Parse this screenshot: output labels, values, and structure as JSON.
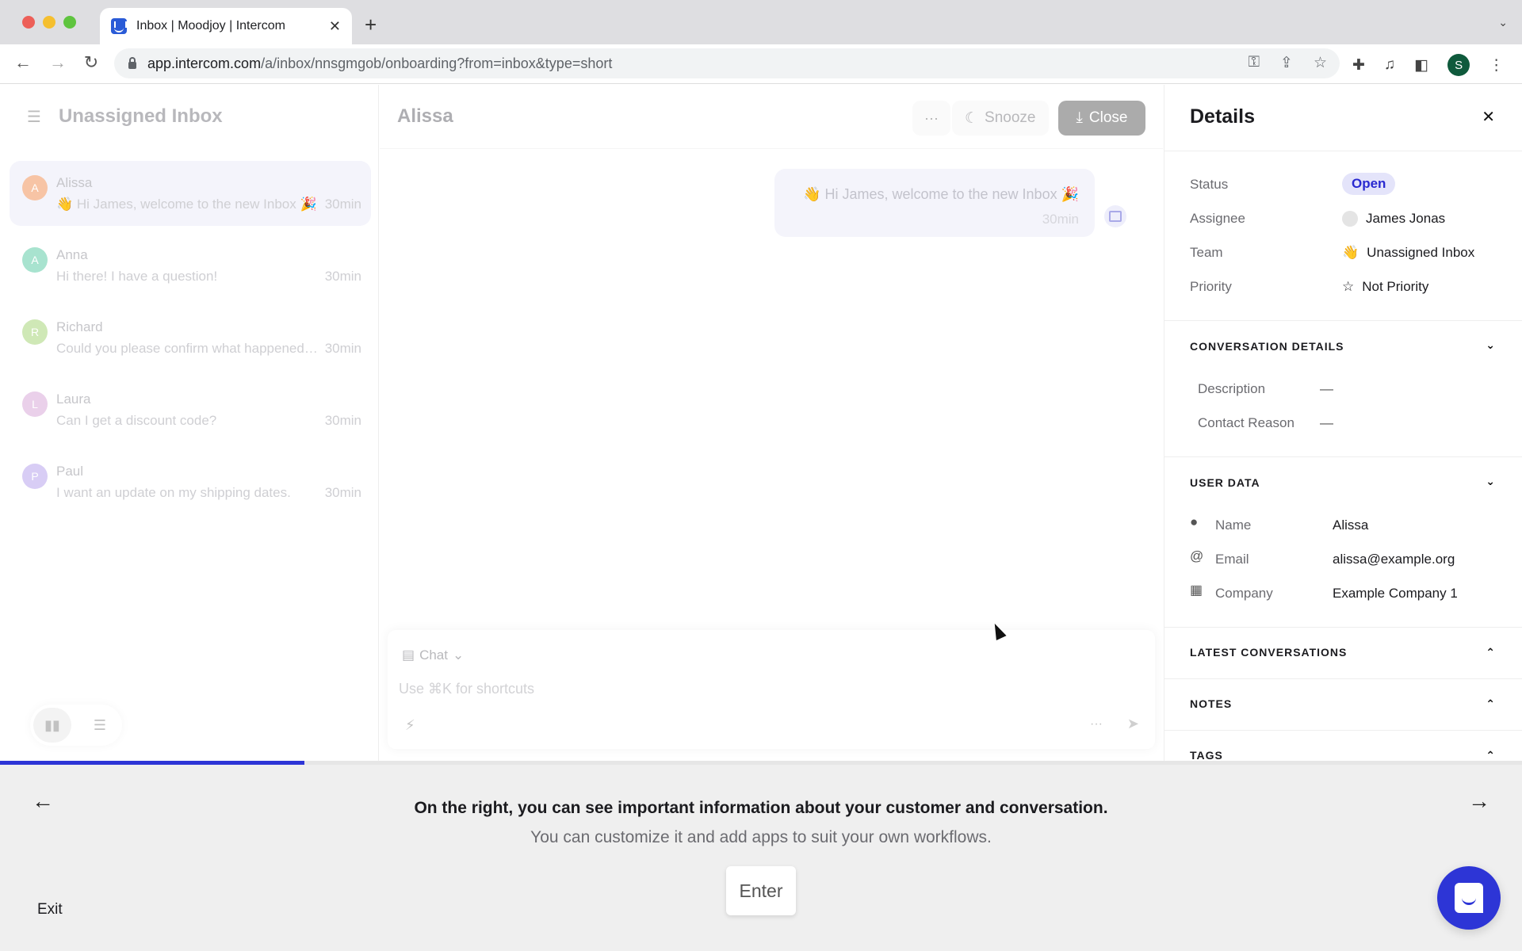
{
  "browser": {
    "tab_title": "Inbox | Moodjoy | Intercom",
    "url_host": "app.intercom.com",
    "url_path": "/a/inbox/nnsgmgob/onboarding?from=inbox&type=short",
    "profile_initial": "S",
    "new_tab": "+",
    "icons": [
      "back-icon",
      "forward-icon",
      "reload-icon",
      "lock-icon",
      "key-icon",
      "share-icon",
      "bookmark-star-icon",
      "extensions-icon",
      "media-icon",
      "sidepanel-icon",
      "kebab-menu-icon"
    ]
  },
  "inbox": {
    "title": "Unassigned Inbox",
    "conversations": [
      {
        "initial": "A",
        "name": "Alissa",
        "preview": "👋 Hi James, welcome to the new Inbox 🎉",
        "time": "30min",
        "color": "#f7c4a5",
        "active": true
      },
      {
        "initial": "A",
        "name": "Anna",
        "preview": "Hi there! I have a question!",
        "time": "30min",
        "color": "#a8e3cf"
      },
      {
        "initial": "R",
        "name": "Richard",
        "preview": "Could you please confirm what happened with my order?",
        "time": "30min",
        "color": "#cfe8b6"
      },
      {
        "initial": "L",
        "name": "Laura",
        "preview": "Can I get a discount code?",
        "time": "30min",
        "color": "#ead0ea"
      },
      {
        "initial": "P",
        "name": "Paul",
        "preview": "I want an update on my shipping dates.",
        "time": "30min",
        "color": "#d8cdf5"
      }
    ]
  },
  "conversation": {
    "title": "Alissa",
    "more_label": "···",
    "snooze_label": "Snooze",
    "close_label": "Close",
    "message": {
      "text": "👋 Hi James, welcome to the new Inbox 🎉",
      "time": "30min"
    },
    "composer": {
      "type_label": "Chat",
      "placeholder": "Use ⌘K for shortcuts",
      "value": ""
    }
  },
  "details": {
    "title": "Details",
    "attributes": [
      {
        "label": "Status",
        "value": "Open"
      },
      {
        "label": "Assignee",
        "value": "James Jonas"
      },
      {
        "label": "Team",
        "value": "Unassigned Inbox"
      },
      {
        "label": "Priority",
        "value": "Not Priority"
      }
    ],
    "conversation_details": {
      "title": "CONVERSATION DETAILS",
      "rows": [
        {
          "label": "Description",
          "value": "—"
        },
        {
          "label": "Contact Reason",
          "value": "—"
        }
      ]
    },
    "user_data": {
      "title": "USER DATA",
      "rows": [
        {
          "icon": "person-icon",
          "label": "Name",
          "value": "Alissa"
        },
        {
          "icon": "at-icon",
          "label": "Email",
          "value": "alissa@example.org"
        },
        {
          "icon": "building-icon",
          "label": "Company",
          "value": "Example Company 1"
        }
      ]
    },
    "collapsed_sections": [
      "LATEST CONVERSATIONS",
      "NOTES",
      "TAGS"
    ]
  },
  "onboarding": {
    "progress_percent": 20,
    "title": "On the right, you can see important information about your customer and conversation.",
    "subtitle": "You can customize it and add apps to suit your own workflows.",
    "enter_label": "Enter",
    "exit_label": "Exit"
  },
  "colors": {
    "accent": "#2d35d6",
    "status_open_bg": "#e4e4fa",
    "status_open_text": "#2a2ad0"
  }
}
